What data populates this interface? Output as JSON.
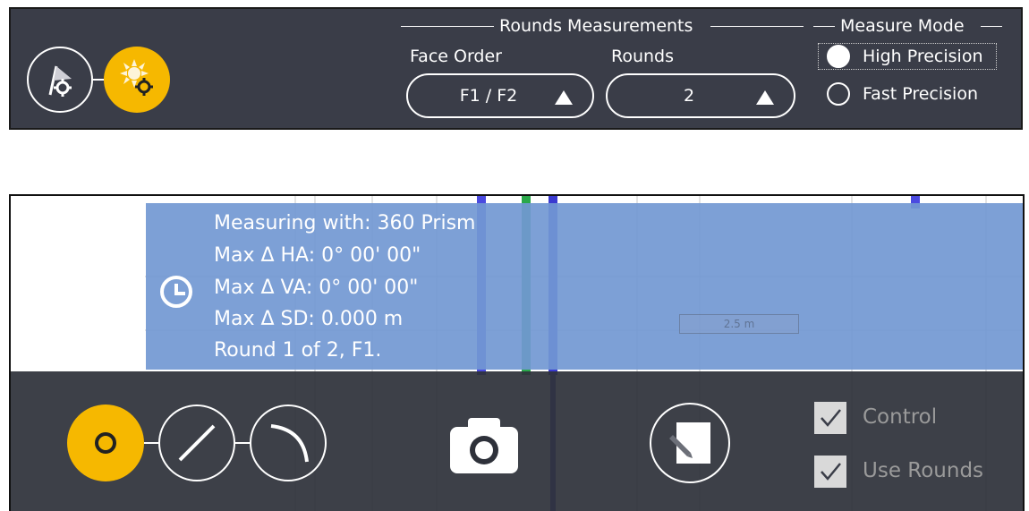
{
  "colors": {
    "panel_bg": "#3a3d48",
    "accent_yellow": "#f6b800",
    "info_blue": "#7298d2",
    "toolbar_bg": "#2e313a"
  },
  "top_panel": {
    "buttons": [
      {
        "icon": "station-flag-settings-icon"
      },
      {
        "icon": "sun-settings-icon",
        "active": true
      }
    ],
    "rounds_section": {
      "title": "Rounds Measurements",
      "face_order": {
        "label": "Face Order",
        "value": "F1 / F2"
      },
      "rounds": {
        "label": "Rounds",
        "value": "2"
      }
    },
    "measure_mode": {
      "title": "Measure Mode",
      "options": [
        {
          "label": "High Precision",
          "selected": true
        },
        {
          "label": "Fast Precision",
          "selected": false
        }
      ]
    }
  },
  "measure_view": {
    "info": {
      "lines": [
        "Measuring with: 360 Prism",
        "Max Δ HA: 0° 00' 00\"",
        "Max Δ VA: 0° 00' 00\"",
        "Max Δ SD: 0.000 m",
        "Round 1 of 2, F1."
      ],
      "dimension_label": "2.5 m"
    },
    "toolbar": {
      "mode_buttons": [
        {
          "icon": "point-icon",
          "active": true
        },
        {
          "icon": "line-icon",
          "active": false
        },
        {
          "icon": "arc-icon",
          "active": false
        }
      ],
      "camera_icon": "camera-icon",
      "note_icon": "note-pencil-icon",
      "checkboxes": [
        {
          "label": "Control",
          "checked": true
        },
        {
          "label": "Use Rounds",
          "checked": true
        }
      ]
    }
  }
}
